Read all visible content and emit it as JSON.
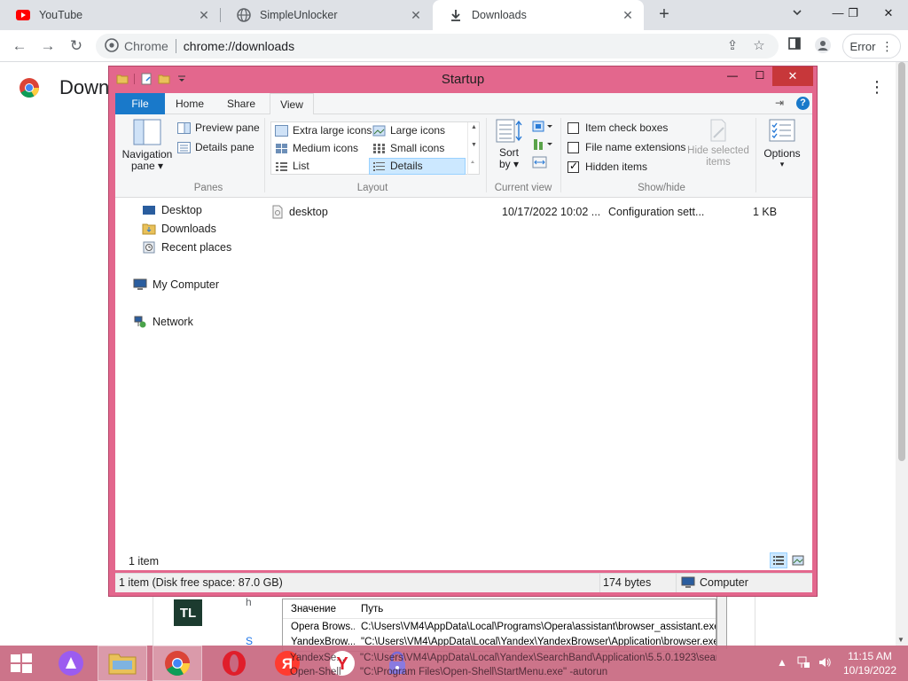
{
  "browser": {
    "tabs": [
      {
        "label": "YouTube",
        "icon": "youtube-icon"
      },
      {
        "label": "SimpleUnlocker",
        "icon": "globe-icon"
      },
      {
        "label": "Downloads",
        "icon": "download-icon",
        "active": true
      }
    ],
    "omnibox_site": "Chrome",
    "omnibox_url": "chrome://downloads",
    "error_button": "Error"
  },
  "page": {
    "title": "Down",
    "tl_logo": "TL",
    "peek_h": "h",
    "peek_s": "S"
  },
  "registry": {
    "headers": {
      "value": "Значение",
      "path": "Путь"
    },
    "rows": [
      {
        "name": "Opera Brows...",
        "path": "C:\\Users\\VM4\\AppData\\Local\\Programs\\Opera\\assistant\\browser_assistant.exe"
      },
      {
        "name": "YandexBrow...",
        "path": "\"C:\\Users\\VM4\\AppData\\Local\\Yandex\\YandexBrowser\\Application\\browser.exe\""
      },
      {
        "name": "YandexSe...",
        "path": "\"C:\\Users\\VM4\\AppData\\Local\\Yandex\\SearchBand\\Application\\5.5.0.1923\\sear..."
      },
      {
        "name": "Open-Shell",
        "path": "\"C:\\Program Files\\Open-Shell\\StartMenu.exe\" -autorun"
      }
    ]
  },
  "explorer": {
    "title": "Startup",
    "ribbon_tabs": {
      "file": "File",
      "home": "Home",
      "share": "Share",
      "view": "View"
    },
    "panes": {
      "navigation_pane": "Navigation",
      "navigation_pane_2": "pane",
      "preview_pane": "Preview pane",
      "details_pane": "Details pane",
      "group": "Panes"
    },
    "layout": {
      "extra_large": "Extra large icons",
      "large": "Large icons",
      "medium": "Medium icons",
      "small": "Small icons",
      "list": "List",
      "details": "Details",
      "group": "Layout"
    },
    "current_view": {
      "sort_by": "Sort",
      "sort_by_2": "by",
      "group": "Current view"
    },
    "show_hide": {
      "item_check_boxes": "Item check boxes",
      "file_name_extensions": "File name extensions",
      "hidden_items": "Hidden items",
      "hide_selected": "Hide selected",
      "hide_selected_2": "items",
      "group": "Show/hide",
      "checked": {
        "item_check_boxes": false,
        "file_name_extensions": false,
        "hidden_items": true
      }
    },
    "options": "Options",
    "nav": {
      "desktop": "Desktop",
      "downloads": "Downloads",
      "recent_places": "Recent places",
      "my_computer": "My Computer",
      "network": "Network"
    },
    "files": [
      {
        "name": "desktop",
        "date": "10/17/2022 10:02 ...",
        "type": "Configuration sett...",
        "size": "1 KB"
      }
    ],
    "item_count": "1 item",
    "status": {
      "free_space": "1 item (Disk free space: 87.0 GB)",
      "size": "174 bytes",
      "location": "Computer"
    }
  },
  "taskbar": {
    "time": "11:15 AM",
    "date": "10/19/2022"
  },
  "colors": {
    "explorer_frame": "#e3678d",
    "close_button": "#c7373a",
    "file_tab": "#1979ca",
    "taskbar": "#c86880"
  }
}
